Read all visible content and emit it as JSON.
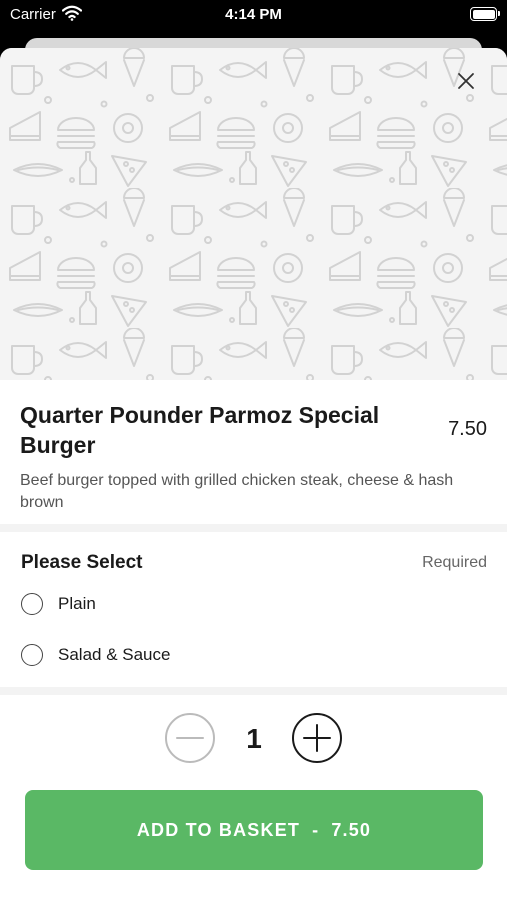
{
  "status_bar": {
    "carrier": "Carrier",
    "time": "4:14 PM",
    "icons": [
      "wifi-icon",
      "battery-icon"
    ]
  },
  "hero": {
    "image": "food-doodle-pattern",
    "close_icon": "close-icon"
  },
  "item": {
    "name": "Quarter Pounder Parmoz Special Burger",
    "price": "7.50",
    "description": "Beef burger topped with grilled chicken steak, cheese & hash brown"
  },
  "option_group": {
    "title": "Please Select",
    "required_label": "Required",
    "options": [
      {
        "label": "Plain",
        "selected": false
      },
      {
        "label": "Salad & Sauce",
        "selected": false
      }
    ]
  },
  "quantity": {
    "value": "1",
    "minus_icon": "minus-icon",
    "plus_icon": "plus-icon"
  },
  "add_button": {
    "label": "ADD TO BASKET",
    "separator": "-",
    "price": "7.50"
  },
  "colors": {
    "accent_green": "#5ab865",
    "hero_background": "#f4f4f4",
    "pattern_stroke": "#d2d2d2"
  }
}
